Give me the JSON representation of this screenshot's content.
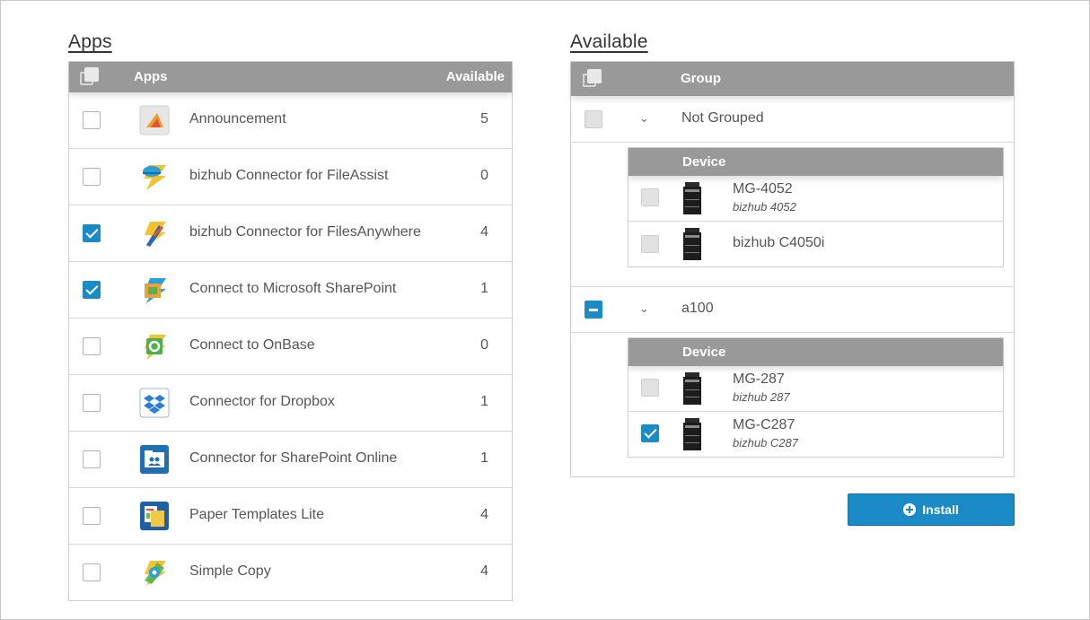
{
  "apps_panel": {
    "title": "Apps",
    "header": {
      "name_col": "Apps",
      "count_col": "Available"
    },
    "rows": [
      {
        "name": "Announcement",
        "count": "5",
        "checked": false,
        "icon": "announcement-icon"
      },
      {
        "name": "bizhub Connector for FileAssist",
        "count": "0",
        "checked": false,
        "icon": "fileassist-icon"
      },
      {
        "name": "bizhub Connector for FilesAnywhere",
        "count": "4",
        "checked": true,
        "icon": "filesanywhere-icon"
      },
      {
        "name": "Connect to Microsoft SharePoint",
        "count": "1",
        "checked": true,
        "icon": "sharepoint-icon"
      },
      {
        "name": "Connect to OnBase",
        "count": "0",
        "checked": false,
        "icon": "onbase-icon"
      },
      {
        "name": "Connector for Dropbox",
        "count": "1",
        "checked": false,
        "icon": "dropbox-icon"
      },
      {
        "name": "Connector for SharePoint Online",
        "count": "1",
        "checked": false,
        "icon": "sharepoint-online-icon"
      },
      {
        "name": "Paper Templates Lite",
        "count": "4",
        "checked": false,
        "icon": "paper-templates-icon"
      },
      {
        "name": "Simple Copy",
        "count": "4",
        "checked": false,
        "icon": "simple-copy-icon"
      }
    ]
  },
  "available_panel": {
    "title": "Available",
    "header": {
      "group_col": "Group"
    },
    "groups": [
      {
        "name": "Not Grouped",
        "state": "unchecked",
        "device_header": "Device",
        "devices": [
          {
            "name": "MG-4052",
            "model": "bizhub 4052",
            "checked": false
          },
          {
            "name": "bizhub C4050i",
            "model": "",
            "checked": false
          }
        ]
      },
      {
        "name": "a100",
        "state": "partial",
        "device_header": "Device",
        "devices": [
          {
            "name": "MG-287",
            "model": "bizhub 287",
            "checked": false
          },
          {
            "name": "MG-C287",
            "model": "bizhub C287",
            "checked": true
          }
        ]
      }
    ]
  },
  "install_button": {
    "label": "Install"
  },
  "colors": {
    "header_bg": "#999999",
    "accent": "#1a8bc6"
  }
}
